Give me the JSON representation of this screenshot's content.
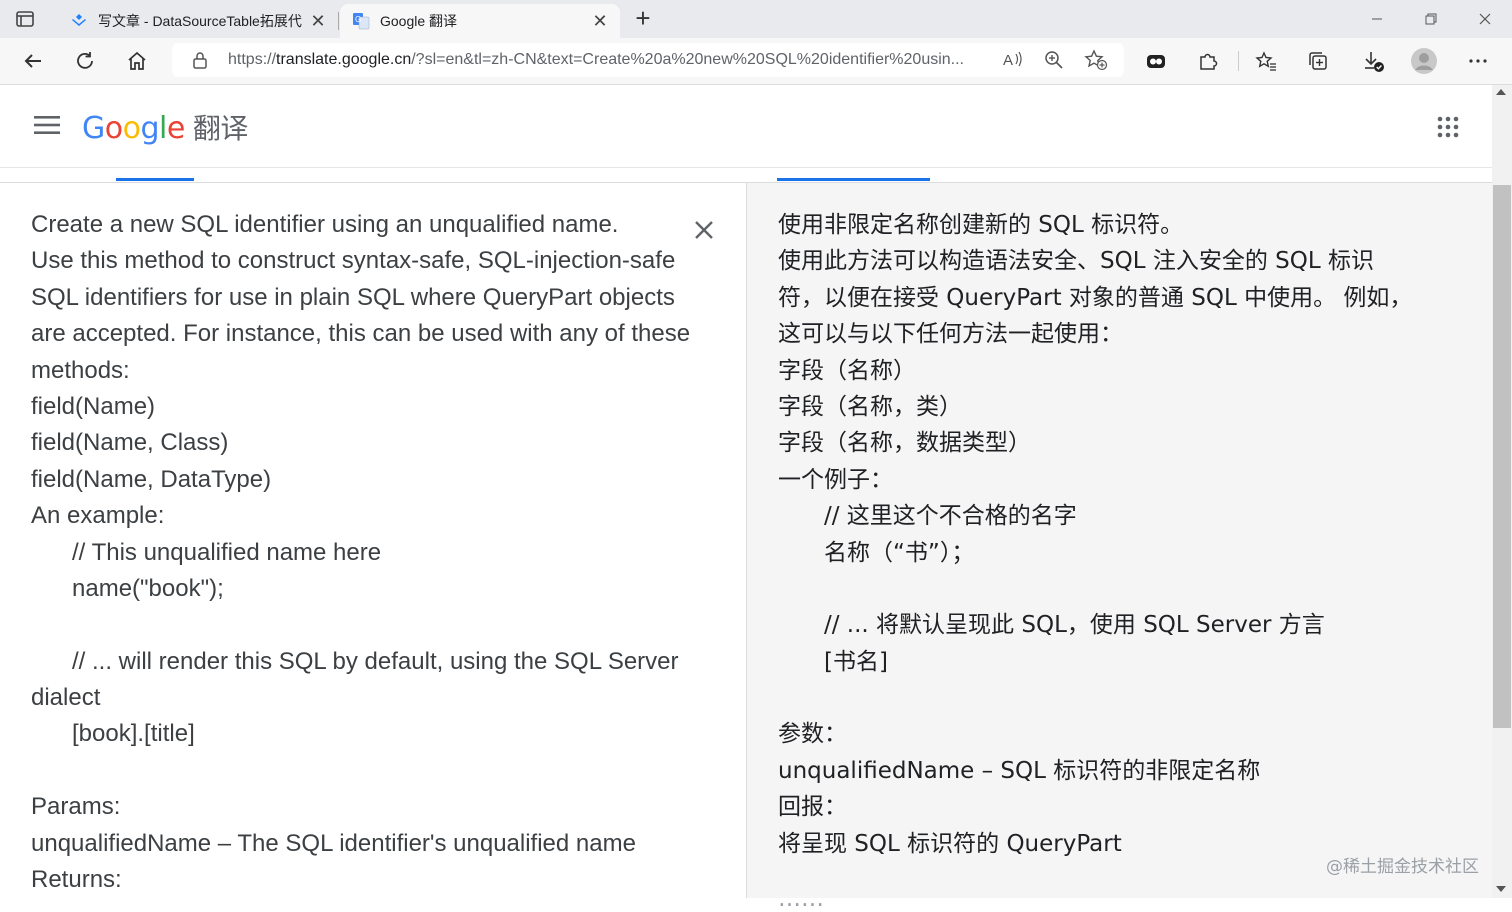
{
  "tabs": [
    {
      "title": "写文章 - DataSourceTable拓展代",
      "active": false
    },
    {
      "title": "Google 翻译",
      "active": true
    }
  ],
  "address_bar": {
    "url_prefix": "https://",
    "url_host": "translate.google.cn",
    "url_rest": "/?sl=en&tl=zh-CN&text=Create%20a%20new%20SQL%20identifier%20usin..."
  },
  "header": {
    "logo_letters": [
      "G",
      "o",
      "o",
      "g",
      "l",
      "e"
    ],
    "product": "翻译"
  },
  "source_lines": [
    {
      "text": "Create a new SQL identifier using an unqualified name.",
      "indent": false
    },
    {
      "text": "Use this method to construct syntax-safe, SQL-injection-safe",
      "indent": false
    },
    {
      "text": "SQL identifiers for use in plain SQL where QueryPart objects",
      "indent": false
    },
    {
      "text": "are accepted. For instance, this can be used with any of these",
      "indent": false
    },
    {
      "text": "methods:",
      "indent": false
    },
    {
      "text": "field(Name)",
      "indent": false
    },
    {
      "text": "field(Name, Class)",
      "indent": false
    },
    {
      "text": "field(Name, DataType)",
      "indent": false
    },
    {
      "text": "An example:",
      "indent": false
    },
    {
      "text": "// This unqualified name here",
      "indent": true
    },
    {
      "text": "name(\"book\");",
      "indent": true
    },
    {
      "text": "",
      "indent": false
    },
    {
      "text": "// ... will render this SQL by default, using the SQL Server",
      "indent": true
    },
    {
      "text": "dialect",
      "indent": false
    },
    {
      "text": "[book].[title]",
      "indent": true
    },
    {
      "text": "",
      "indent": false
    },
    {
      "text": "Params:",
      "indent": false
    },
    {
      "text": "unqualifiedName – The SQL identifier's unqualified name",
      "indent": false
    },
    {
      "text": "Returns:",
      "indent": false
    }
  ],
  "target_lines": [
    {
      "text": "使用非限定名称创建新的 SQL 标识符。",
      "indent": false
    },
    {
      "text": "使用此方法可以构造语法安全、SQL 注入安全的 SQL 标识",
      "indent": false
    },
    {
      "text": "符，以便在接受 QueryPart 对象的普通 SQL 中使用。 例如，",
      "indent": false
    },
    {
      "text": "这可以与以下任何方法一起使用：",
      "indent": false
    },
    {
      "text": "字段（名称）",
      "indent": false
    },
    {
      "text": "字段（名称，类）",
      "indent": false
    },
    {
      "text": "字段（名称，数据类型）",
      "indent": false
    },
    {
      "text": "一个例子：",
      "indent": false
    },
    {
      "text": "// 这里这个不合格的名字",
      "indent": true
    },
    {
      "text": "名称（“书”）；",
      "indent": true
    },
    {
      "text": "",
      "indent": false
    },
    {
      "text": "// ... 将默认呈现此 SQL，使用 SQL Server 方言",
      "indent": true
    },
    {
      "text": "[书名]",
      "indent": true
    },
    {
      "text": "",
      "indent": false
    },
    {
      "text": "参数：",
      "indent": false
    },
    {
      "text": "unqualifiedName – SQL 标识符的非限定名称",
      "indent": false
    },
    {
      "text": "回报：",
      "indent": false
    },
    {
      "text": "将呈现 SQL 标识符的 QueryPart",
      "indent": false
    }
  ],
  "watermark": "@稀土掘金技术社区",
  "colors": {
    "accent": "#1a73e8",
    "logo": [
      "#4285f4",
      "#ea4335",
      "#fbbc05",
      "#4285f4",
      "#34a853",
      "#ea4335"
    ]
  }
}
